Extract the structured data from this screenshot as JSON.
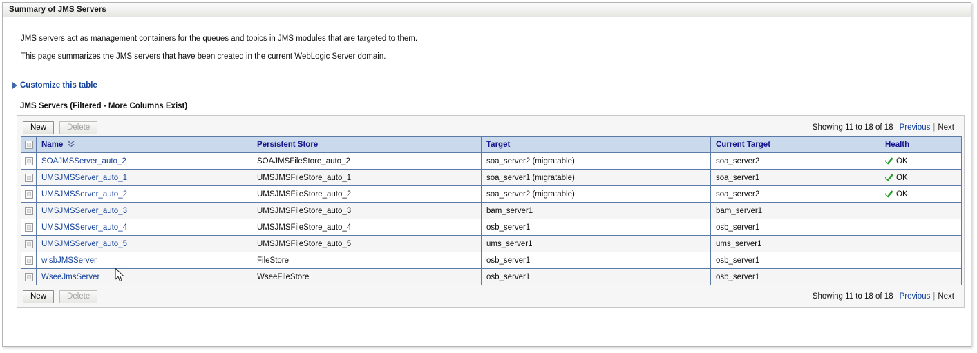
{
  "window": {
    "title": "Summary of JMS Servers"
  },
  "description": {
    "line1": "JMS servers act as management containers for the queues and topics in JMS modules that are targeted to them.",
    "line2": "This page summarizes the JMS servers that have been created in the current WebLogic Server domain."
  },
  "customize": {
    "label": "Customize this table",
    "icon": "triangle-right-icon"
  },
  "table": {
    "caption": "JMS Servers (Filtered - More Columns Exist)",
    "toolbar": {
      "new_label": "New",
      "delete_label": "Delete"
    },
    "pagination": {
      "showing": "Showing 11 to 18 of 18",
      "previous_label": "Previous",
      "separator": "|",
      "next_label": "Next"
    },
    "columns": [
      {
        "key": "select",
        "label": ""
      },
      {
        "key": "name",
        "label": "Name",
        "sort": "ascending"
      },
      {
        "key": "persistent_store",
        "label": "Persistent Store"
      },
      {
        "key": "target",
        "label": "Target"
      },
      {
        "key": "current_target",
        "label": "Current Target"
      },
      {
        "key": "health",
        "label": "Health"
      }
    ],
    "rows": [
      {
        "name": "SOAJMSServer_auto_2",
        "persistent_store": "SOAJMSFileStore_auto_2",
        "target": "soa_server2 (migratable)",
        "current_target": "soa_server2",
        "health": "OK"
      },
      {
        "name": "UMSJMSServer_auto_1",
        "persistent_store": "UMSJMSFileStore_auto_1",
        "target": "soa_server1 (migratable)",
        "current_target": "soa_server1",
        "health": "OK"
      },
      {
        "name": "UMSJMSServer_auto_2",
        "persistent_store": "UMSJMSFileStore_auto_2",
        "target": "soa_server2 (migratable)",
        "current_target": "soa_server2",
        "health": "OK"
      },
      {
        "name": "UMSJMSServer_auto_3",
        "persistent_store": "UMSJMSFileStore_auto_3",
        "target": "bam_server1",
        "current_target": "bam_server1",
        "health": ""
      },
      {
        "name": "UMSJMSServer_auto_4",
        "persistent_store": "UMSJMSFileStore_auto_4",
        "target": "osb_server1",
        "current_target": "osb_server1",
        "health": ""
      },
      {
        "name": "UMSJMSServer_auto_5",
        "persistent_store": "UMSJMSFileStore_auto_5",
        "target": "ums_server1",
        "current_target": "ums_server1",
        "health": ""
      },
      {
        "name": "wlsbJMSServer",
        "persistent_store": "FileStore",
        "target": "osb_server1",
        "current_target": "osb_server1",
        "health": ""
      },
      {
        "name": "WseeJmsServer",
        "persistent_store": "WseeFileStore",
        "target": "osb_server1",
        "current_target": "osb_server1",
        "health": ""
      }
    ]
  },
  "colors": {
    "link": "#15429b",
    "header_bg": "#cbd9ed",
    "header_text": "#15158c",
    "grid_border": "#5c7ba6",
    "row_alt_bg": "#f5f5f5",
    "health_ok": "#1f9a1f"
  }
}
